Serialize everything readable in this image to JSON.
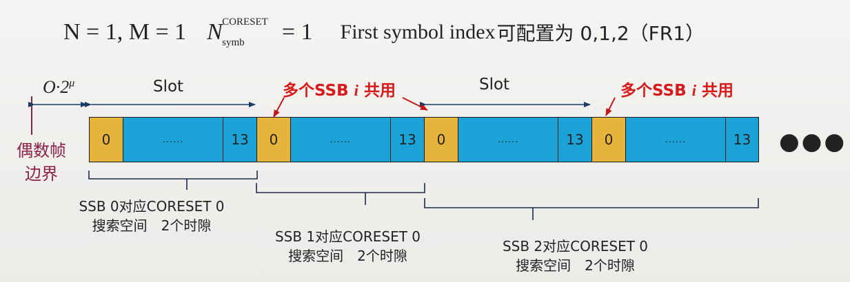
{
  "header": {
    "formula_nm": "N = 1, M = 1",
    "n_symbol": "N",
    "n_sup": "CORESET",
    "n_sub": "symb",
    "n_value": "= 1",
    "text_en": "First symbol index",
    "text_cn": "可配置为 0,1,2（FR1）"
  },
  "labels": {
    "offset": "O·2^μ",
    "slot": "Slot",
    "shared": "多个SSB i 共用",
    "boundary_line1": "偶数帧",
    "boundary_line2": "边界"
  },
  "slots": [
    {
      "first": "0",
      "middle": "......",
      "last": "13"
    },
    {
      "first": "0",
      "middle": "......",
      "last": "13"
    },
    {
      "first": "0",
      "middle": "......",
      "last": "13"
    },
    {
      "first": "0",
      "middle": "......",
      "last": "13"
    }
  ],
  "captions": [
    {
      "line1": "SSB 0对应CORESET 0",
      "line2": "搜索空间　2个时隙"
    },
    {
      "line1": "SSB 1对应CORESET 0",
      "line2": "搜索空间　2个时隙"
    },
    {
      "line1": "SSB 2对应CORESET 0",
      "line2": "搜索空间　2个时隙"
    }
  ],
  "continuation": "●●●",
  "colors": {
    "yellow_symbol": "#e7b43b",
    "blue_symbol": "#1ba3d8",
    "annotation_red": "#d71a1a",
    "boundary_purple": "#8a2246"
  }
}
